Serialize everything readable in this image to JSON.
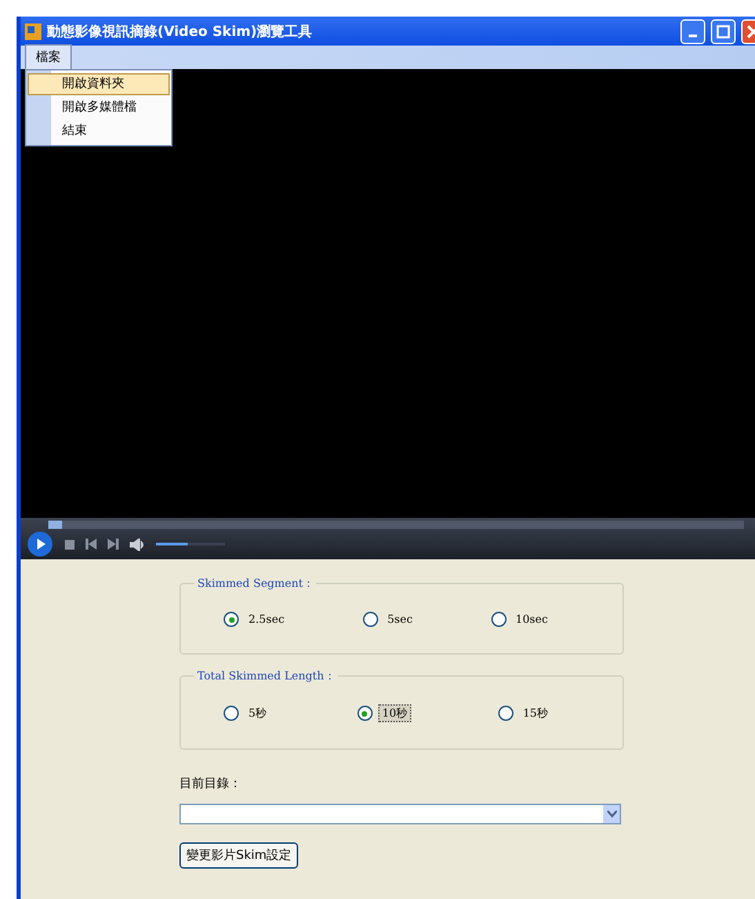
{
  "window": {
    "title": "動態影像視訊摘錄(Video Skim)瀏覽工具"
  },
  "menu_bar": [
    {
      "label": "檔案",
      "expanded": true
    }
  ],
  "menu": {
    "items": [
      {
        "label": "開啟資料夾",
        "selected": true
      },
      {
        "label": "開啟多媒體檔",
        "selected": false
      },
      {
        "label": "結束",
        "selected": false
      }
    ]
  },
  "player": {
    "seek": {
      "level": 0.02
    },
    "volume": {
      "level": 0.45
    }
  },
  "groups": [
    {
      "title": "Skimmed Segment：",
      "options": [
        {
          "label": "2.5sec",
          "selected": true,
          "focused": false
        },
        {
          "label": "5sec",
          "selected": false,
          "focused": false
        },
        {
          "label": "10sec",
          "selected": false,
          "focused": false
        }
      ]
    },
    {
      "title": "Total Skimmed Length：",
      "options": [
        {
          "label": "5秒",
          "selected": false,
          "focused": false
        },
        {
          "label": "10秒",
          "selected": true,
          "focused": true
        },
        {
          "label": "15秒",
          "selected": false,
          "focused": false
        }
      ]
    }
  ],
  "directory": {
    "label": "目前目錄："
  },
  "buttons": [
    "變更影片Skim設定"
  ]
}
